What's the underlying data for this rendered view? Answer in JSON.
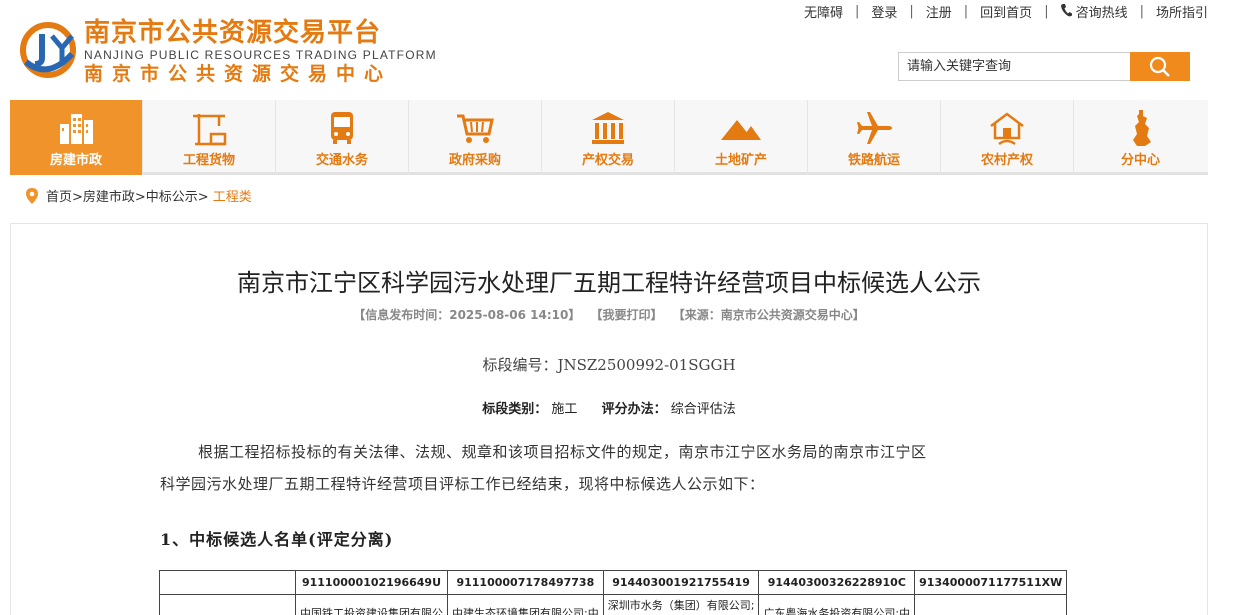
{
  "topbar": {
    "items": [
      "无障碍",
      "登录",
      "注册",
      "回到首页",
      "咨询热线",
      "场所指引"
    ],
    "separator": "|"
  },
  "logo": {
    "cn_name": "南京市公共资源交易平台",
    "en_name": "NANJING PUBLIC RESOURCES TRADING PLATFORM",
    "center_name": "南京市公共资源交易中心"
  },
  "search": {
    "placeholder": "请输入关键字查询",
    "icon": "search-icon"
  },
  "nav": {
    "items": [
      {
        "label": "房建市政",
        "icon": "buildings-icon",
        "active": true
      },
      {
        "label": "工程货物",
        "icon": "crane-icon",
        "active": false
      },
      {
        "label": "交通水务",
        "icon": "bus-icon",
        "active": false
      },
      {
        "label": "政府采购",
        "icon": "cart-icon",
        "active": false
      },
      {
        "label": "产权交易",
        "icon": "bank-icon",
        "active": false
      },
      {
        "label": "土地矿产",
        "icon": "mountain-icon",
        "active": false
      },
      {
        "label": "铁路航运",
        "icon": "airplane-icon",
        "active": false
      },
      {
        "label": "农村产权",
        "icon": "house-icon",
        "active": false
      },
      {
        "label": "分中心",
        "icon": "tower-icon",
        "active": false
      }
    ]
  },
  "breadcrumb": {
    "path": "首页>房建市政>中标公示>",
    "current": "工程类"
  },
  "article": {
    "title": "南京市江宁区科学园污水处理厂五期工程特许经营项目中标候选人公示",
    "meta_time": "【信息发布时间：2025-08-06 14:10】",
    "meta_print": "【我要打印】",
    "meta_source": "【来源：南京市公共资源交易中心】",
    "bid_no": "标段编号：JNSZ2500992-01SGGH",
    "category_label": "标段类别：",
    "category_value": "施工",
    "method_label": "评分办法：",
    "method_value": "综合评估法",
    "para_line1": "根据工程招标投标的有关法律、法规、规章和该项目招标文件的规定，南京市江宁区水务局的南京市江宁区",
    "para_line2": "科学园污水处理厂五期工程特许经营项目评标工作已经结束，现将中标候选人公示如下：",
    "section_title": "1、中标候选人名单(评定分离)"
  },
  "table": {
    "codes": [
      "",
      "91110000102196649U",
      "911100007178497738",
      "914403001921755419",
      "91440300326228910C",
      "9134000071177511XW"
    ],
    "names": [
      "",
      "中国铁工投资建设集团有限公",
      "中建生态环境集团有限公司;中",
      "深圳市水务（集团）有限公司;",
      "广东粤海水务投资有限公司;中",
      ""
    ]
  },
  "colors": {
    "brand_orange": "#e47a12",
    "nav_active": "#f0932b",
    "search_button": "#f08a1d"
  }
}
